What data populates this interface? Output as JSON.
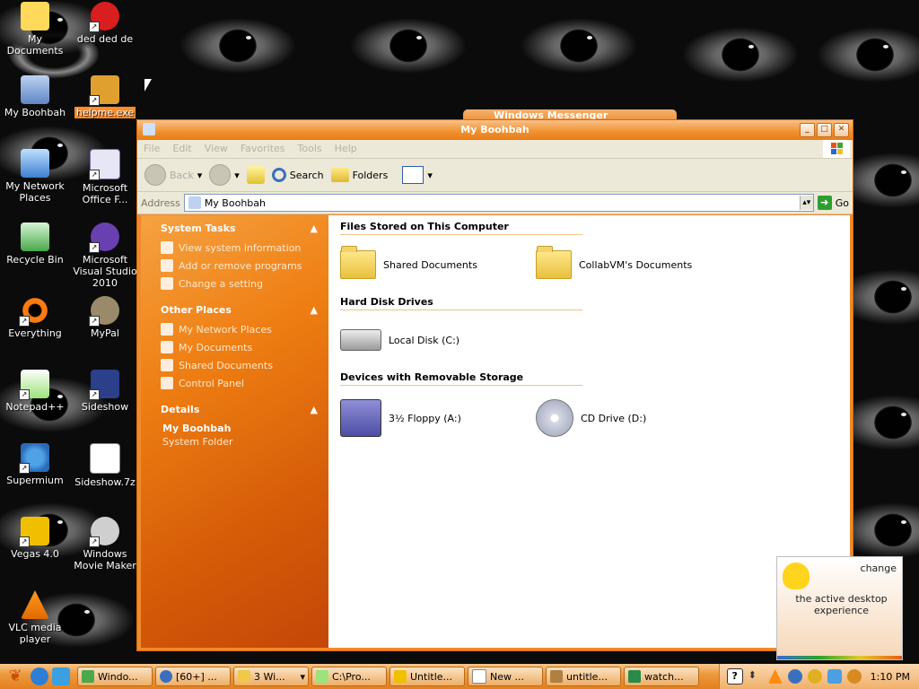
{
  "desktop": {
    "icons": [
      {
        "label": "My Documents"
      },
      {
        "label": "ded ded de"
      },
      {
        "label": "My Boohbah"
      },
      {
        "label": "helpme.exe"
      },
      {
        "label": "My Network Places"
      },
      {
        "label": "Microsoft Office F..."
      },
      {
        "label": "Recycle Bin"
      },
      {
        "label": "Microsoft Visual Studio 2010"
      },
      {
        "label": "Everything"
      },
      {
        "label": "MyPal"
      },
      {
        "label": "Notepad++"
      },
      {
        "label": "Sideshow"
      },
      {
        "label": "Supermium"
      },
      {
        "label": "Sideshow.7z"
      },
      {
        "label": "Vegas 4.0"
      },
      {
        "label": "Windows Movie Maker"
      },
      {
        "label": "VLC media player"
      }
    ],
    "background_window_title": "Windows Messenger"
  },
  "window": {
    "title": "My Boohbah",
    "menu": [
      "File",
      "Edit",
      "View",
      "Favorites",
      "Tools",
      "Help"
    ],
    "toolbar": {
      "back": "Back",
      "search": "Search",
      "folders": "Folders"
    },
    "address": {
      "label": "Address",
      "value": "My Boohbah",
      "go": "Go"
    },
    "sidebar": {
      "system_tasks": {
        "title": "System Tasks",
        "items": [
          "View system information",
          "Add or remove programs",
          "Change a setting"
        ]
      },
      "other_places": {
        "title": "Other Places",
        "items": [
          "My Network Places",
          "My Documents",
          "Shared Documents",
          "Control Panel"
        ]
      },
      "details": {
        "title": "Details",
        "name": "My Boohbah",
        "type": "System Folder"
      }
    },
    "sections": [
      {
        "title": "Files Stored on This Computer",
        "items": [
          "Shared Documents",
          "CollabVM's Documents"
        ]
      },
      {
        "title": "Hard Disk Drives",
        "items": [
          "Local Disk (C:)"
        ]
      },
      {
        "title": "Devices with Removable Storage",
        "items": [
          "3½ Floppy (A:)",
          "CD Drive (D:)"
        ]
      }
    ]
  },
  "notification": {
    "link": "change",
    "message": "the active desktop experience"
  },
  "taskbar": {
    "tasks": [
      "Windo...",
      "[60+] ...",
      "3 Wi...",
      "C:\\Pro...",
      "Untitle...",
      "New ...",
      "untitle...",
      "watch..."
    ],
    "clock": "1:10 PM"
  },
  "colors": {
    "accent": "#f08a2c",
    "sidebar": "#e06a10",
    "taskbar": "#ec9a3f"
  }
}
